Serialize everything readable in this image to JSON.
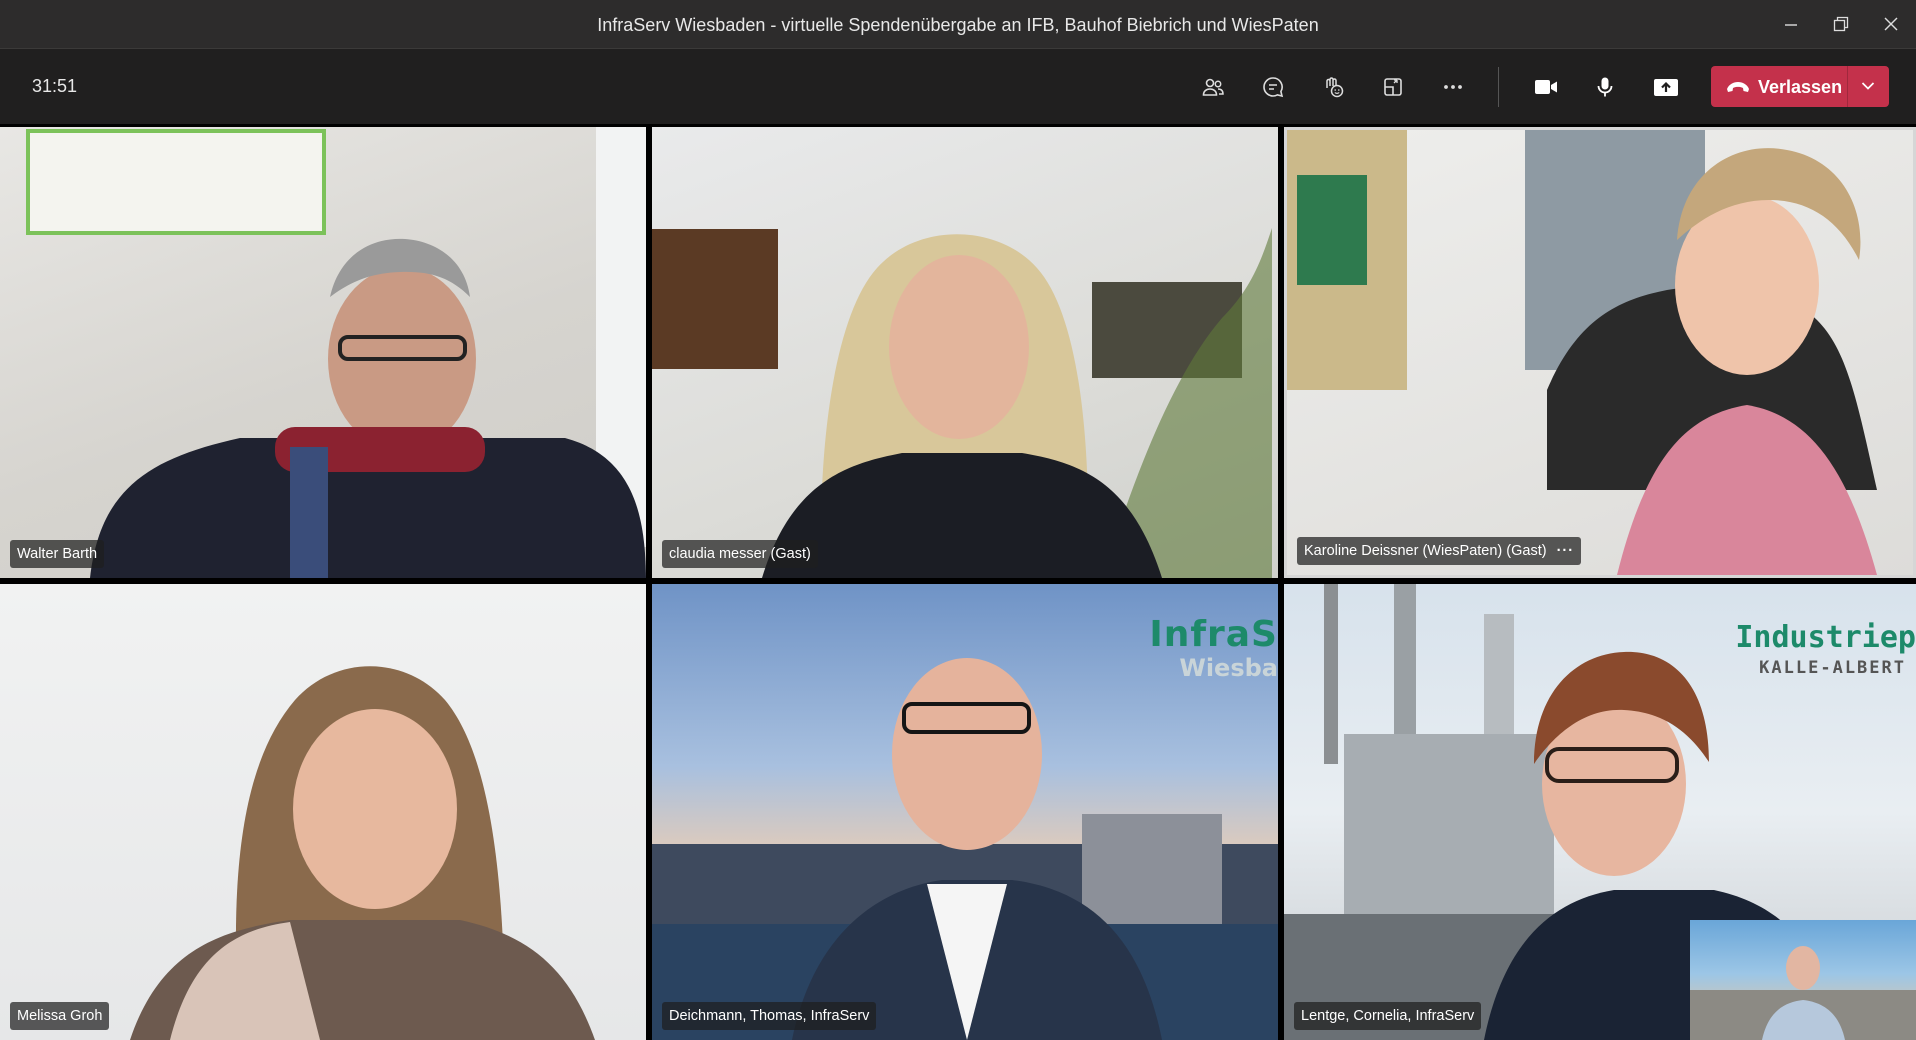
{
  "window": {
    "title": "InfraServ Wiesbaden - virtuelle Spendenübergabe an IFB, Bauhof Biebrich und WiesPaten"
  },
  "toolbar": {
    "timer": "31:51",
    "leave_label": "Verlassen",
    "icons": [
      "participants-icon",
      "chat-icon",
      "reactions-icon",
      "rooms-icon",
      "more-icon",
      "camera-icon",
      "mic-icon",
      "share-icon",
      "hangup-icon",
      "chevron-down-icon"
    ],
    "leave_color": "#c4314b"
  },
  "participants": [
    {
      "name": "Walter Barth"
    },
    {
      "name": "claudia messer (Gast)"
    },
    {
      "name": "Karoline Deissner (WiesPaten) (Gast)",
      "more": "···",
      "active": true
    },
    {
      "name": "Melissa Groh"
    },
    {
      "name": "Deichmann, Thomas, InfraServ",
      "brand_top": "InfraS",
      "brand_bottom": "Wiesba"
    },
    {
      "name": "Lentge, Cornelia, InfraServ",
      "brand_top": "Industriep",
      "brand_bottom": "KALLE-ALBERT"
    }
  ],
  "colors": {
    "titlebar": "#2d2c2c",
    "toolbar": "#201f1f",
    "brand_green": "#1d8a6a"
  }
}
